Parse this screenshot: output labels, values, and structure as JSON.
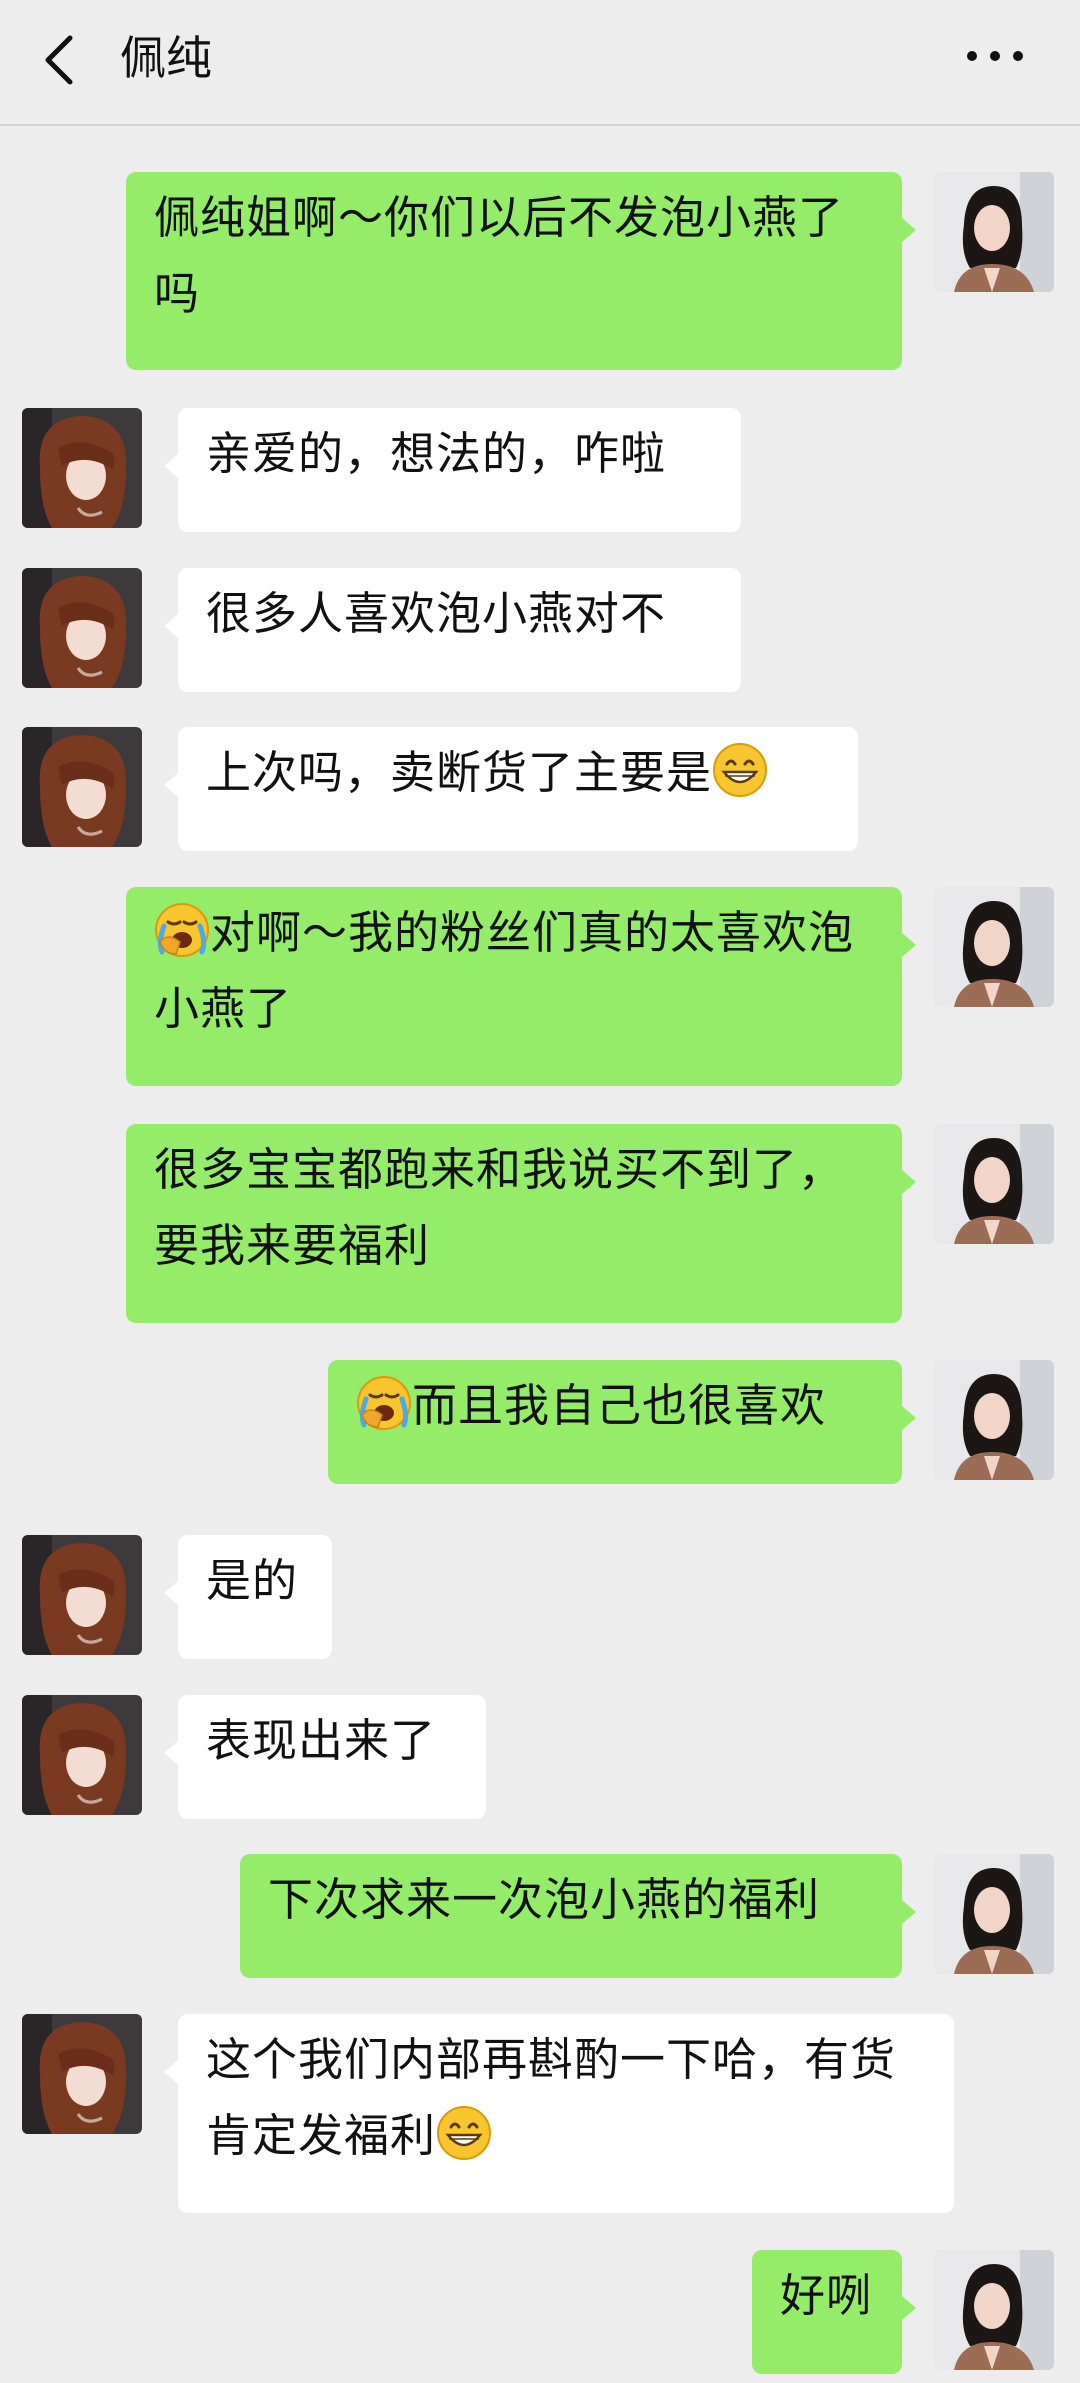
{
  "header": {
    "title": "佩纯",
    "back_icon": "chevron-left-icon",
    "more_icon": "more-dots-icon"
  },
  "colors": {
    "background": "#ededed",
    "outgoing_bubble": "#95ec69",
    "incoming_bubble": "#ffffff"
  },
  "messages": [
    {
      "side": "out",
      "text": "佩纯姐啊～你们以后不发泡小燕了吗"
    },
    {
      "side": "in",
      "text": "亲爱的，想法的，咋啦"
    },
    {
      "side": "in",
      "text": "很多人喜欢泡小燕对不"
    },
    {
      "side": "in",
      "text": "上次吗，卖断货了主要是",
      "emoji_after": "grinning-face-icon"
    },
    {
      "side": "out",
      "text": "对啊～我的粉丝们真的太喜欢泡小燕了",
      "emoji_before": "face-palm-crying-icon"
    },
    {
      "side": "out",
      "text": "很多宝宝都跑来和我说买不到了，要我来要福利"
    },
    {
      "side": "out",
      "text": "而且我自己也很喜欢",
      "emoji_before": "face-palm-crying-icon"
    },
    {
      "side": "in",
      "text": "是的"
    },
    {
      "side": "in",
      "text": "表现出来了"
    },
    {
      "side": "out",
      "text": "下次求来一次泡小燕的福利"
    },
    {
      "side": "in",
      "text": "这个我们内部再斟酌一下哈，有货肯定发福利",
      "emoji_after": "grinning-face-icon"
    },
    {
      "side": "out",
      "text": "好咧"
    }
  ]
}
